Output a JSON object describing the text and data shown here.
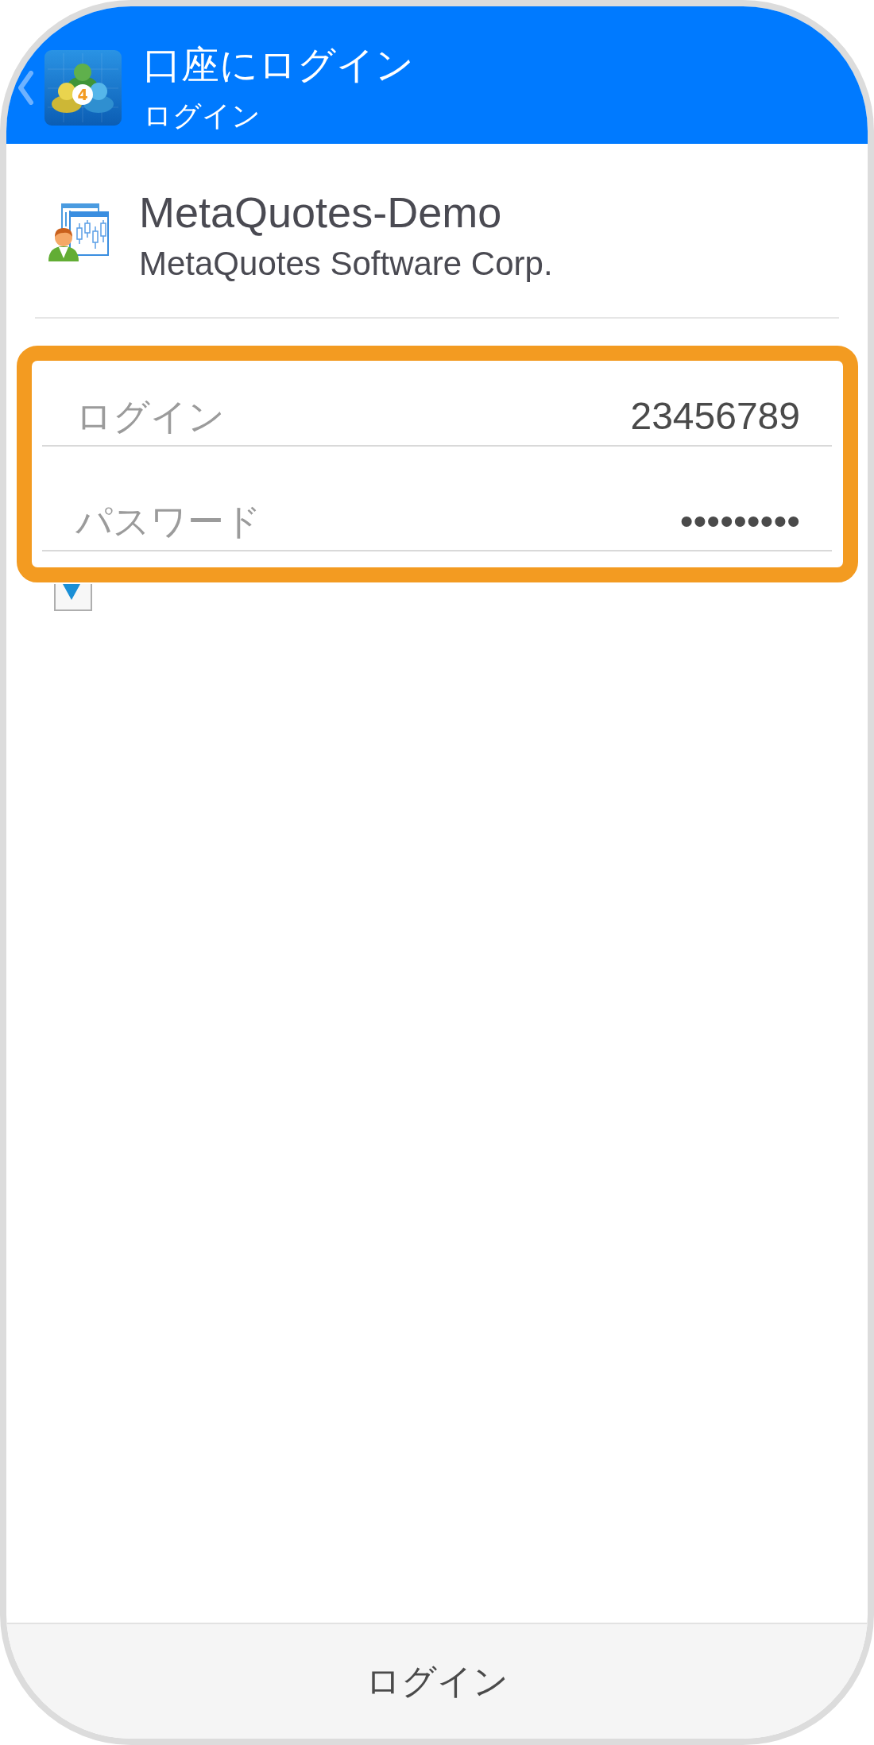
{
  "header": {
    "title": "口座にログイン",
    "subtitle": "ログイン",
    "logo_badge": "4"
  },
  "server": {
    "name": "MetaQuotes-Demo",
    "company": "MetaQuotes Software Corp."
  },
  "credentials": {
    "highlighted": true,
    "fields": [
      {
        "label": "ログイン",
        "value": "23456789"
      },
      {
        "label": "パスワード",
        "value": "•••••••••"
      }
    ]
  },
  "save_password": {
    "checked": true
  },
  "login_button": {
    "label": "ログイン"
  }
}
